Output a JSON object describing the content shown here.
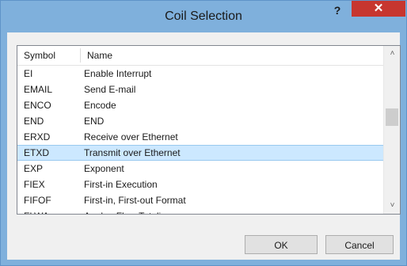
{
  "window": {
    "title": "Coil Selection",
    "help_label": "?",
    "close_label": "✕"
  },
  "list": {
    "columns": {
      "symbol": "Symbol",
      "name": "Name"
    },
    "rows": [
      {
        "symbol": "EI",
        "name": "Enable Interrupt",
        "selected": false
      },
      {
        "symbol": "EMAIL",
        "name": "Send E-mail",
        "selected": false
      },
      {
        "symbol": "ENCO",
        "name": "Encode",
        "selected": false
      },
      {
        "symbol": "END",
        "name": "END",
        "selected": false
      },
      {
        "symbol": "ERXD",
        "name": "Receive over Ethernet",
        "selected": false
      },
      {
        "symbol": "ETXD",
        "name": "Transmit over Ethernet",
        "selected": true
      },
      {
        "symbol": "EXP",
        "name": "Exponent",
        "selected": false
      },
      {
        "symbol": "FIEX",
        "name": "First-in Execution",
        "selected": false
      },
      {
        "symbol": "FIFOF",
        "name": "First-in, First-out Format",
        "selected": false
      },
      {
        "symbol": "FLWA",
        "name": "Analog Flow Totalizer",
        "selected": false
      }
    ]
  },
  "buttons": {
    "ok": "OK",
    "cancel": "Cancel"
  }
}
